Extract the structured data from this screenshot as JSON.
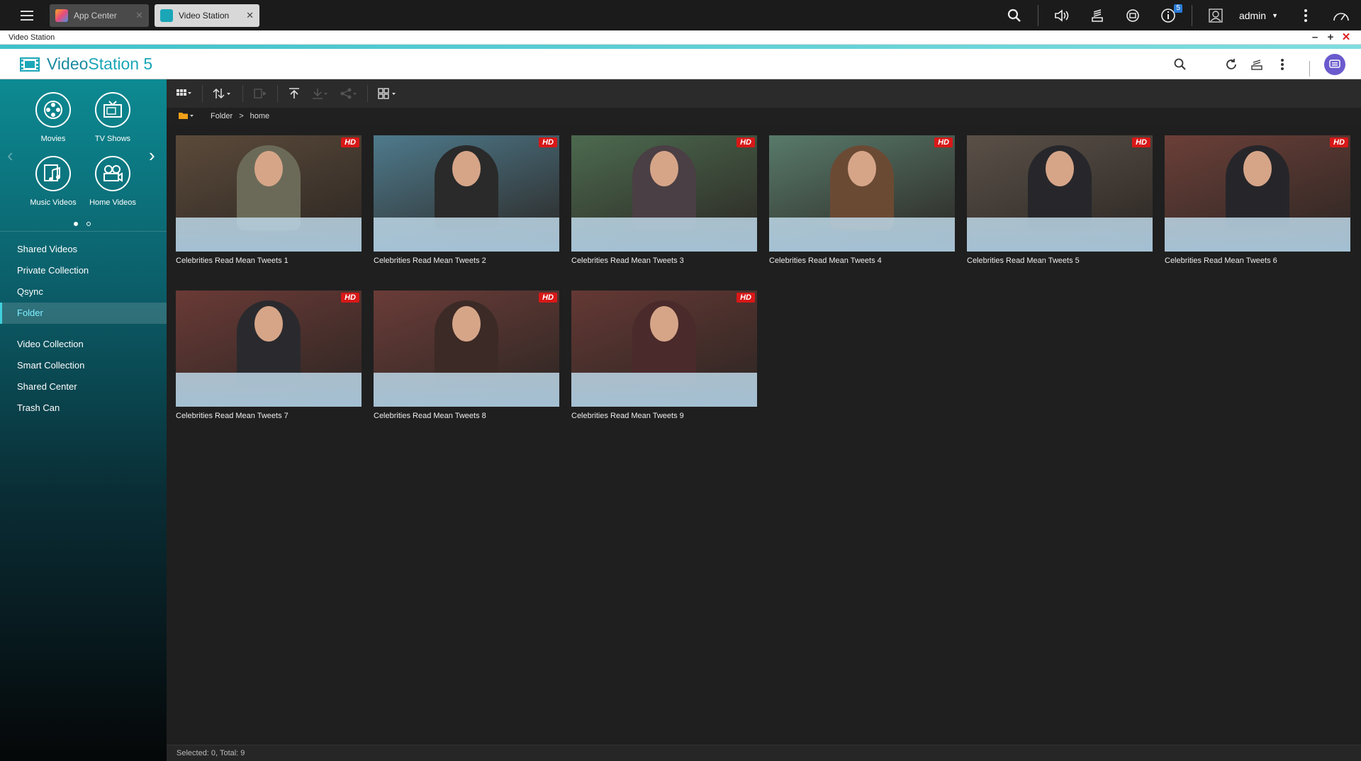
{
  "system_bar": {
    "tabs": [
      {
        "label": "App Center",
        "icon": "app-center-icon",
        "active": false
      },
      {
        "label": "Video Station",
        "icon": "video-station-icon",
        "active": true
      }
    ],
    "info_badge": "5",
    "user": "admin"
  },
  "window": {
    "title": "Video Station"
  },
  "app": {
    "name_part1": "Video",
    "name_part2": "Station 5",
    "accent": "#3fc1c9"
  },
  "categories": [
    {
      "label": "Movies",
      "icon": "film-reel-icon"
    },
    {
      "label": "TV Shows",
      "icon": "tv-icon"
    },
    {
      "label": "Music Videos",
      "icon": "music-video-icon"
    },
    {
      "label": "Home Videos",
      "icon": "camera-icon"
    }
  ],
  "nav": {
    "group1": [
      "Shared Videos",
      "Private Collection",
      "Qsync",
      "Folder"
    ],
    "active": "Folder",
    "group2": [
      "Video Collection",
      "Smart Collection",
      "Shared Center",
      "Trash Can"
    ]
  },
  "breadcrumb": {
    "root": "Folder",
    "separator": ">",
    "current": "home"
  },
  "videos": [
    {
      "title": "Celebrities Read Mean Tweets 1",
      "badge": "HD",
      "bg": "#5b4a3a",
      "shirt": "#6b6a58"
    },
    {
      "title": "Celebrities Read Mean Tweets 2",
      "badge": "HD",
      "bg": "#4e7a8c",
      "shirt": "#2a2a2a"
    },
    {
      "title": "Celebrities Read Mean Tweets 3",
      "badge": "HD",
      "bg": "#4c6a4f",
      "shirt": "#4a3f44"
    },
    {
      "title": "Celebrities Read Mean Tweets 4",
      "badge": "HD",
      "bg": "#587a6a",
      "shirt": "#6b4a34"
    },
    {
      "title": "Celebrities Read Mean Tweets 5",
      "badge": "HD",
      "bg": "#5a5048",
      "shirt": "#27272b"
    },
    {
      "title": "Celebrities Read Mean Tweets 6",
      "badge": "HD",
      "bg": "#6b3f38",
      "shirt": "#26262a"
    },
    {
      "title": "Celebrities Read Mean Tweets 7",
      "badge": "HD",
      "bg": "#6a3a36",
      "shirt": "#2a2a2e"
    },
    {
      "title": "Celebrities Read Mean Tweets 8",
      "badge": "HD",
      "bg": "#6a3c38",
      "shirt": "#3c2a26"
    },
    {
      "title": "Celebrities Read Mean Tweets 9",
      "badge": "HD",
      "bg": "#643834",
      "shirt": "#4a2a2a"
    }
  ],
  "status": "Selected: 0, Total: 9"
}
